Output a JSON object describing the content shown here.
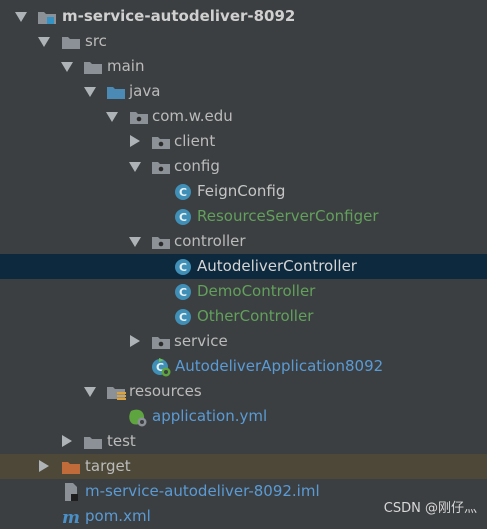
{
  "project_tree": {
    "module": "m-service-autodeliver-8092",
    "src": "src",
    "main": "main",
    "java": "java",
    "package": "com.w.edu",
    "client": "client",
    "config": "config",
    "feign_config": "FeignConfig",
    "resource_server_configer": "ResourceServerConfiger",
    "controller": "controller",
    "autodeliver_controller": "AutodeliverController",
    "demo_controller": "DemoController",
    "other_controller": "OtherController",
    "service": "service",
    "autodeliver_application": "AutodeliverApplication8092",
    "resources": "resources",
    "application_yml": "application.yml",
    "test": "test",
    "target": "target",
    "iml_file": "m-service-autodeliver-8092.iml",
    "pom": "pom.xml"
  },
  "watermark": "CSDN @刚仔灬",
  "colors": {
    "background": "#3c3f41",
    "selected_row": "#0d293e",
    "excluded_row": "#4d4838",
    "text": "#bbbbbb",
    "new_file_green": "#62a05c",
    "yml_blue": "#5a9bd5",
    "class_icon": "#3f8fb7",
    "folder_gray": "#8b9196",
    "source_folder_blue": "#4a8ab5",
    "target_folder_orange": "#c06b39"
  }
}
